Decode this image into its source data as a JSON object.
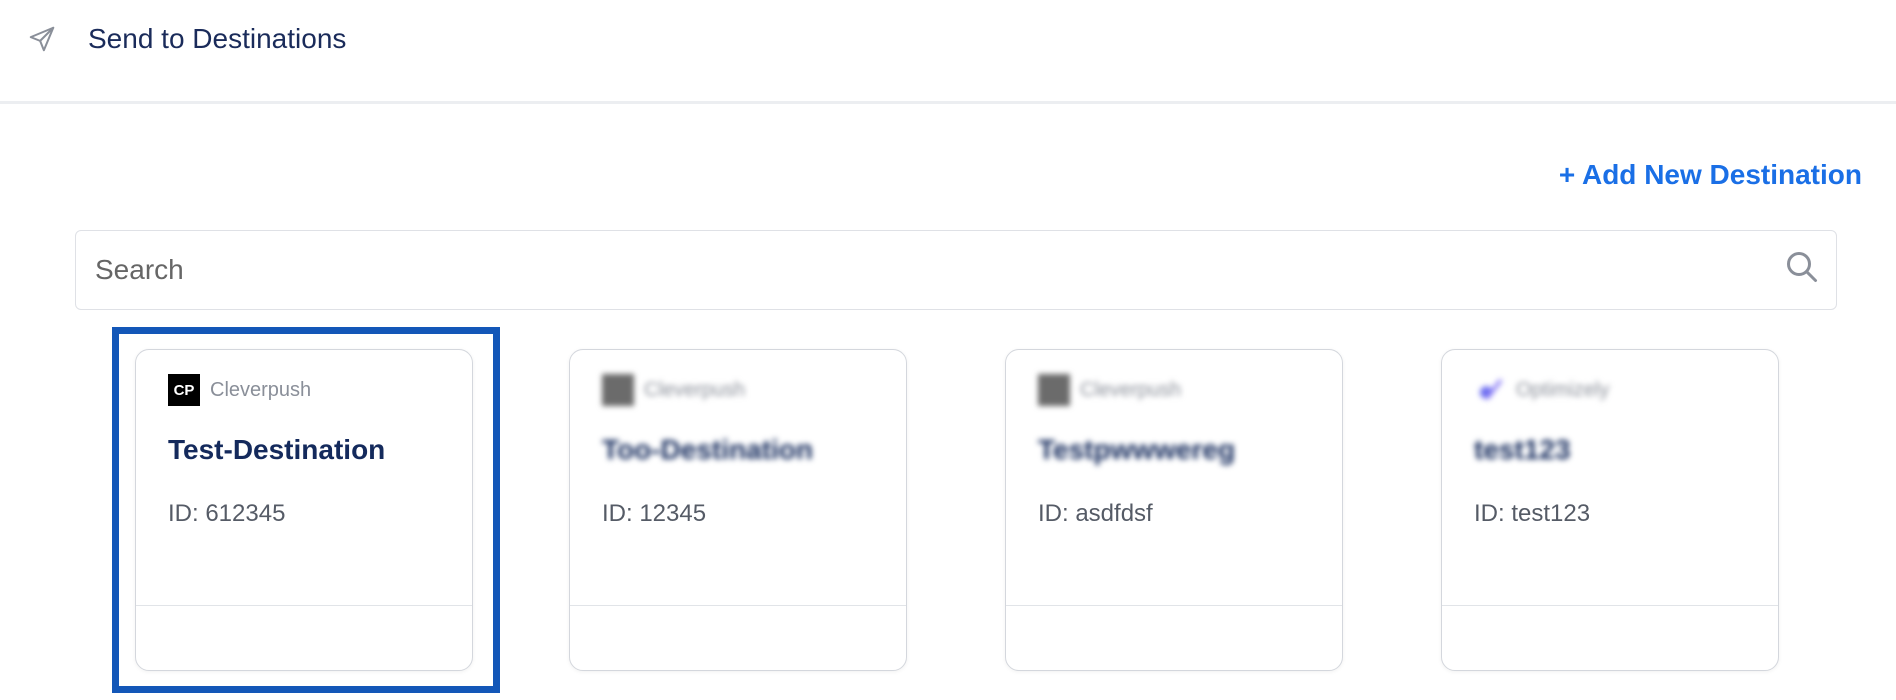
{
  "header": {
    "title": "Send to Destinations",
    "icon": "send-icon"
  },
  "actions": {
    "add_label": "+ Add New Destination"
  },
  "search": {
    "placeholder": "Search",
    "value": "",
    "icon": "search-icon"
  },
  "colors": {
    "accent": "#1a6fe6",
    "title": "#142a5c",
    "selection": "#1357b8"
  },
  "destinations": [
    {
      "logo": "CP",
      "brand": "Cleverpush",
      "name": "Test-Destination",
      "id": "ID: 612345",
      "selected": true,
      "blurred": false
    },
    {
      "logo": "",
      "brand": "Cleverpush",
      "name": "Too-Destination",
      "id": "ID: 12345",
      "selected": false,
      "blurred": true
    },
    {
      "logo": "",
      "brand": "Cleverpush",
      "name": "Testpwwwereg",
      "id": "ID: asdfdsf",
      "selected": false,
      "blurred": true
    },
    {
      "logo": "",
      "brand": "Optimizely",
      "name": "test123",
      "id": "ID: test123",
      "selected": false,
      "blurred": true
    }
  ]
}
